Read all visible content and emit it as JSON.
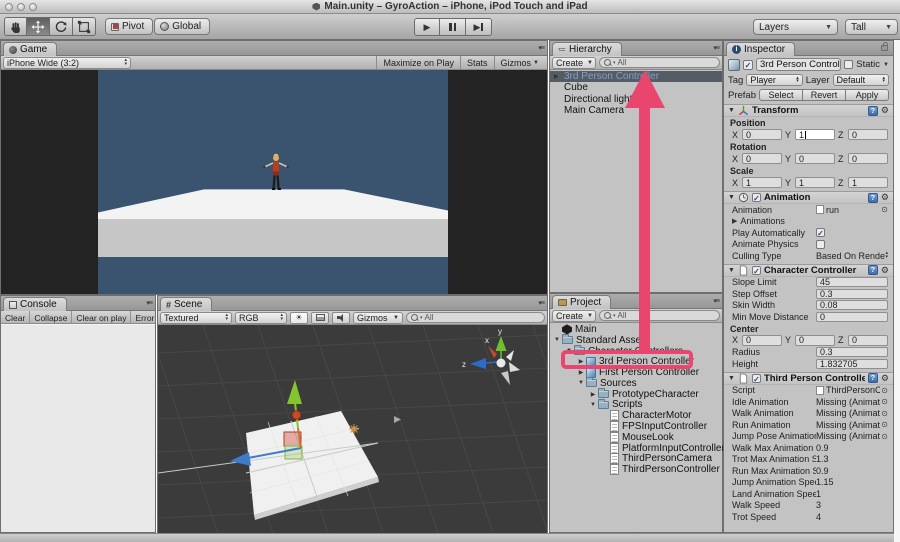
{
  "window": {
    "title": "Main.unity – GyroAction – iPhone, iPod Touch and iPad"
  },
  "toolbar": {
    "pivot_label": "Pivot",
    "global_label": "Global",
    "layers_label": "Layers",
    "layout_label": "Tall"
  },
  "game": {
    "tab": "Game",
    "aspect": "iPhone Wide (3:2)",
    "maximize_label": "Maximize on Play",
    "stats_label": "Stats",
    "gizmos_label": "Gizmos"
  },
  "console": {
    "tab": "Console",
    "buttons": [
      "Clear",
      "Collapse",
      "Clear on play",
      "Error pause"
    ]
  },
  "scene": {
    "tab": "Scene",
    "render_mode": "Textured",
    "color_mode": "RGB",
    "gizmos_label": "Gizmos",
    "search_text": "All"
  },
  "hierarchy": {
    "tab": "Hierarchy",
    "create_label": "Create",
    "search_text": "All",
    "items": [
      {
        "label": "3rd Person Controller",
        "selected": true,
        "expander": true
      },
      {
        "label": "Cube",
        "selected": false,
        "expander": false
      },
      {
        "label": "Directional light",
        "selected": false,
        "expander": false
      },
      {
        "label": "Main Camera",
        "selected": false,
        "expander": false
      }
    ]
  },
  "project": {
    "tab": "Project",
    "create_label": "Create",
    "search_text": "All",
    "tree": [
      {
        "label": "Main",
        "depth": 0,
        "icon": "unity-scene",
        "expander": ""
      },
      {
        "label": "Standard Assets",
        "depth": 0,
        "icon": "folder",
        "expander": "open"
      },
      {
        "label": "Character Controllers",
        "depth": 1,
        "icon": "folder",
        "expander": "open"
      },
      {
        "label": "3rd Person Controller",
        "depth": 2,
        "icon": "prefab",
        "expander": "closed",
        "highlight": true
      },
      {
        "label": "First Person Controller",
        "depth": 2,
        "icon": "prefab",
        "expander": "closed"
      },
      {
        "label": "Sources",
        "depth": 2,
        "icon": "folder",
        "expander": "open"
      },
      {
        "label": "PrototypeCharacter",
        "depth": 3,
        "icon": "folder",
        "expander": "closed"
      },
      {
        "label": "Scripts",
        "depth": 3,
        "icon": "folder",
        "expander": "open"
      },
      {
        "label": "CharacterMotor",
        "depth": 4,
        "icon": "script",
        "expander": ""
      },
      {
        "label": "FPSInputController",
        "depth": 4,
        "icon": "script",
        "expander": ""
      },
      {
        "label": "MouseLook",
        "depth": 4,
        "icon": "script",
        "expander": ""
      },
      {
        "label": "PlatformInputController",
        "depth": 4,
        "icon": "script",
        "expander": ""
      },
      {
        "label": "ThirdPersonCamera",
        "depth": 4,
        "icon": "script",
        "expander": ""
      },
      {
        "label": "ThirdPersonController",
        "depth": 4,
        "icon": "script",
        "expander": ""
      }
    ]
  },
  "inspector": {
    "tab": "Inspector",
    "name": "3rd Person Controller",
    "static_label": "Static",
    "tag_label": "Tag",
    "tag_value": "Player",
    "layer_label": "Layer",
    "layer_value": "Default",
    "prefab_label": "Prefab",
    "prefab_buttons": [
      "Select",
      "Revert",
      "Apply"
    ],
    "axis": [
      "X",
      "Y",
      "Z"
    ],
    "transform": {
      "title": "Transform",
      "position": {
        "label": "Position",
        "x": "0",
        "y": "1",
        "z": "0"
      },
      "rotation": {
        "label": "Rotation",
        "x": "0",
        "y": "0",
        "z": "0"
      },
      "scale": {
        "label": "Scale",
        "x": "1",
        "y": "1",
        "z": "1"
      }
    },
    "animation": {
      "title": "Animation",
      "animation_label": "Animation",
      "animation_value": "run",
      "animations_label": "Animations",
      "play_automatically_label": "Play Automatically",
      "animate_physics_label": "Animate Physics",
      "culling_label": "Culling Type",
      "culling_value": "Based On Render"
    },
    "character_controller": {
      "title": "Character Controller",
      "rows": [
        {
          "label": "Slope Limit",
          "value": "45"
        },
        {
          "label": "Step Offset",
          "value": "0.3"
        },
        {
          "label": "Skin Width",
          "value": "0.08"
        },
        {
          "label": "Min Move Distance",
          "value": "0"
        }
      ],
      "center_label": "Center",
      "center": {
        "x": "0",
        "y": "0",
        "z": "0"
      },
      "rows2": [
        {
          "label": "Radius",
          "value": "0.3"
        },
        {
          "label": "Height",
          "value": "1.832705"
        }
      ]
    },
    "third_person": {
      "title": "Third Person Controller (Sc",
      "script_label": "Script",
      "script_value": "ThirdPersonCc",
      "object_rows": [
        {
          "label": "Idle Animation",
          "value": "Missing (Animatio"
        },
        {
          "label": "Walk Animation",
          "value": "Missing (Animatio"
        },
        {
          "label": "Run Animation",
          "value": "Missing (Animatio"
        },
        {
          "label": "Jump Pose Animation",
          "value": "Missing (Animatio"
        }
      ],
      "num_rows": [
        {
          "label": "Walk Max Animation Sp",
          "value": "0.9"
        },
        {
          "label": "Trot Max Animation Sp",
          "value": "1.3"
        },
        {
          "label": "Run Max Animation Sp",
          "value": "0.9"
        },
        {
          "label": "Jump Animation Speed",
          "value": "1.15"
        },
        {
          "label": "Land Animation Speed",
          "value": "1"
        },
        {
          "label": "Walk Speed",
          "value": "3"
        },
        {
          "label": "Trot Speed",
          "value": "4"
        }
      ]
    }
  },
  "annotation": {
    "color": "#e8466f"
  }
}
